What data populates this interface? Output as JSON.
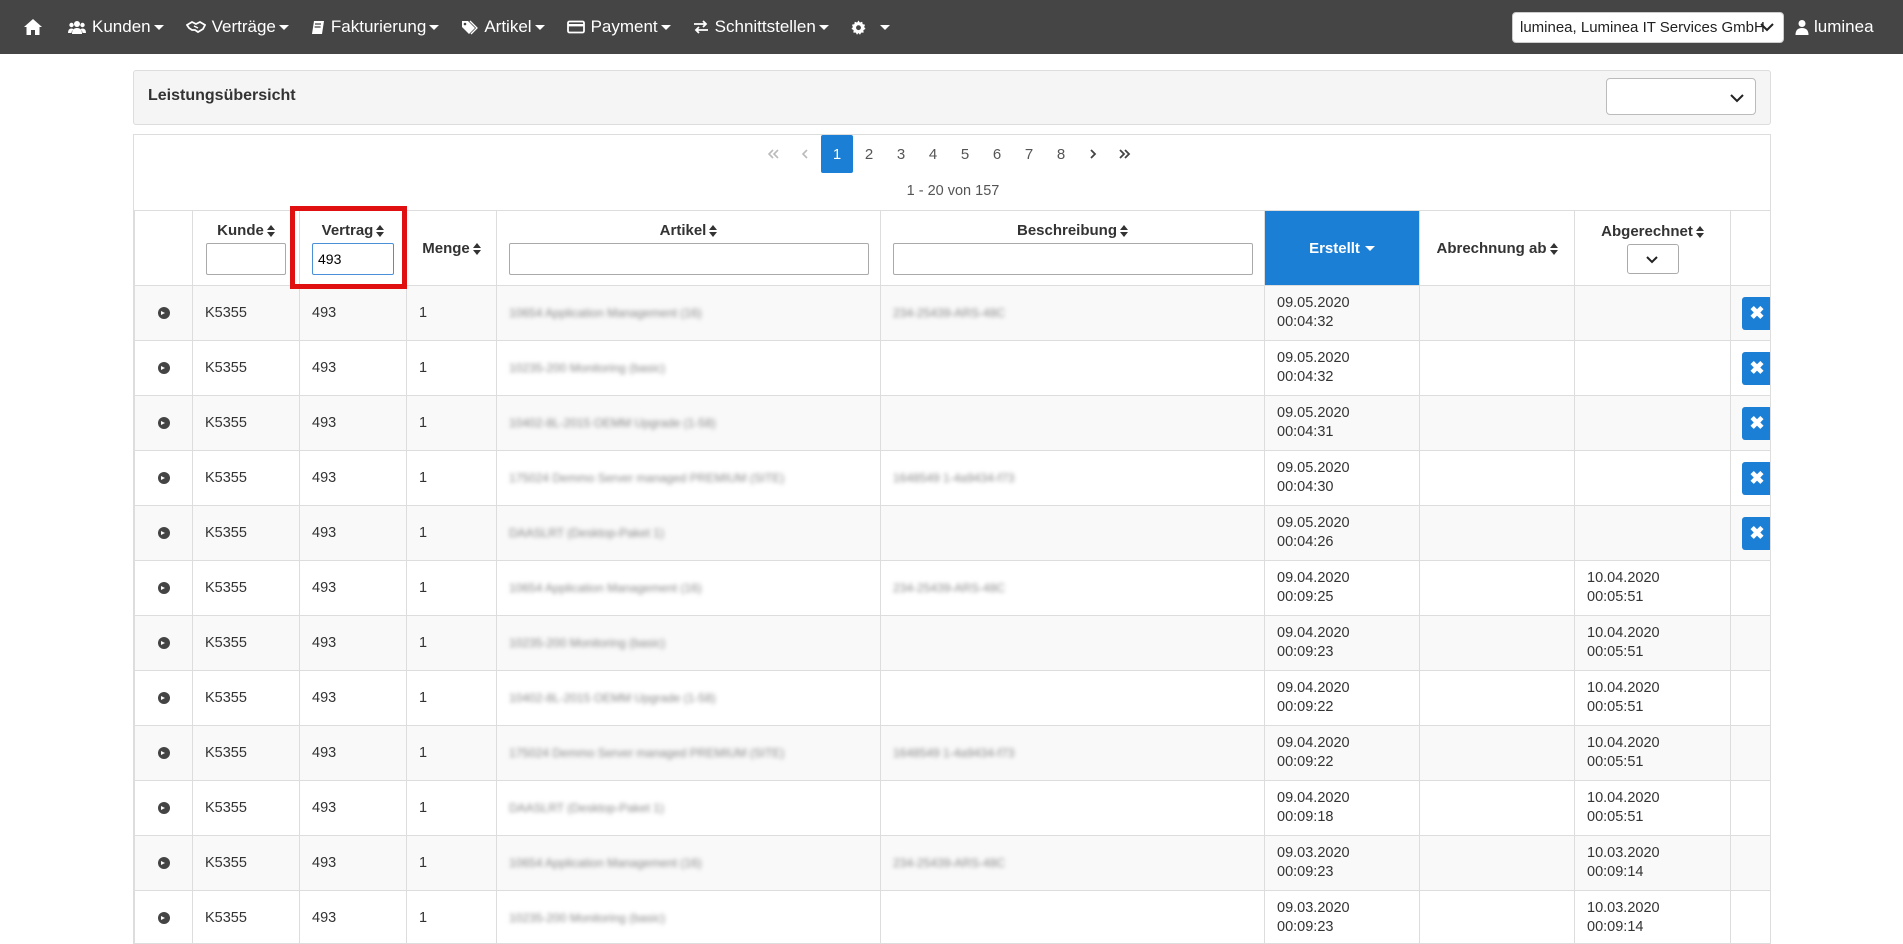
{
  "nav": {
    "items": [
      {
        "label": "Kunden",
        "icon": "users-icon"
      },
      {
        "label": "Verträge",
        "icon": "handshake-icon"
      },
      {
        "label": "Fakturierung",
        "icon": "book-icon"
      },
      {
        "label": "Artikel",
        "icon": "tags-icon"
      },
      {
        "label": "Payment",
        "icon": "credit-card-icon"
      },
      {
        "label": "Schnittstellen",
        "icon": "exchange-icon"
      },
      {
        "label": "",
        "icon": "gear-icon"
      }
    ],
    "tenant": "luminea, Luminea IT Services GmbH",
    "user": "luminea"
  },
  "panel": {
    "title": "Leistungsübersicht"
  },
  "pagination": {
    "pages": [
      "1",
      "2",
      "3",
      "4",
      "5",
      "6",
      "7",
      "8"
    ],
    "active": "1",
    "range_text": "1 - 20 von 157"
  },
  "columns": {
    "kunde": "Kunde",
    "vertrag": "Vertrag",
    "menge": "Menge",
    "artikel": "Artikel",
    "beschreibung": "Beschreibung",
    "erstellt": "Erstellt",
    "abrechnung_ab": "Abrechnung ab",
    "abgerechnet": "Abgerechnet"
  },
  "filters": {
    "kunde": "",
    "vertrag": "493",
    "artikel": "",
    "beschreibung": ""
  },
  "rows": [
    {
      "kunde": "K5355",
      "vertrag": "493",
      "menge": "1",
      "artikel": "10654 Application Management (16)",
      "beschreibung": "234-25439-ARS-48C",
      "erstellt_date": "09.05.2020",
      "erstellt_time": "00:04:32",
      "abgerechnet_date": "",
      "abgerechnet_time": "",
      "deletable": true
    },
    {
      "kunde": "K5355",
      "vertrag": "493",
      "menge": "1",
      "artikel": "10235-200 Monitoring (basic)",
      "beschreibung": "",
      "erstellt_date": "09.05.2020",
      "erstellt_time": "00:04:32",
      "abgerechnet_date": "",
      "abgerechnet_time": "",
      "deletable": true
    },
    {
      "kunde": "K5355",
      "vertrag": "493",
      "menge": "1",
      "artikel": "10402-8L-2015 OEMM Upgrade (1-58)",
      "beschreibung": "",
      "erstellt_date": "09.05.2020",
      "erstellt_time": "00:04:31",
      "abgerechnet_date": "",
      "abgerechnet_time": "",
      "deletable": true
    },
    {
      "kunde": "K5355",
      "vertrag": "493",
      "menge": "1",
      "artikel": "175024 Demmo Server managed PREMIUM (SITE)",
      "beschreibung": "1648549 1-4a9434-f73",
      "erstellt_date": "09.05.2020",
      "erstellt_time": "00:04:30",
      "abgerechnet_date": "",
      "abgerechnet_time": "",
      "deletable": true
    },
    {
      "kunde": "K5355",
      "vertrag": "493",
      "menge": "1",
      "artikel": "DAASLRT (Desktop-Paket 1)",
      "beschreibung": "",
      "erstellt_date": "09.05.2020",
      "erstellt_time": "00:04:26",
      "abgerechnet_date": "",
      "abgerechnet_time": "",
      "deletable": true
    },
    {
      "kunde": "K5355",
      "vertrag": "493",
      "menge": "1",
      "artikel": "10654 Application Management (16)",
      "beschreibung": "234-25439-ARS-48C",
      "erstellt_date": "09.04.2020",
      "erstellt_time": "00:09:25",
      "abgerechnet_date": "10.04.2020",
      "abgerechnet_time": "00:05:51",
      "deletable": false
    },
    {
      "kunde": "K5355",
      "vertrag": "493",
      "menge": "1",
      "artikel": "10235-200 Monitoring (basic)",
      "beschreibung": "",
      "erstellt_date": "09.04.2020",
      "erstellt_time": "00:09:23",
      "abgerechnet_date": "10.04.2020",
      "abgerechnet_time": "00:05:51",
      "deletable": false
    },
    {
      "kunde": "K5355",
      "vertrag": "493",
      "menge": "1",
      "artikel": "10402-8L-2015 OEMM Upgrade (1-58)",
      "beschreibung": "",
      "erstellt_date": "09.04.2020",
      "erstellt_time": "00:09:22",
      "abgerechnet_date": "10.04.2020",
      "abgerechnet_time": "00:05:51",
      "deletable": false
    },
    {
      "kunde": "K5355",
      "vertrag": "493",
      "menge": "1",
      "artikel": "175024 Demmo Server managed PREMIUM (SITE)",
      "beschreibung": "1648549 1-4a9434-f73",
      "erstellt_date": "09.04.2020",
      "erstellt_time": "00:09:22",
      "abgerechnet_date": "10.04.2020",
      "abgerechnet_time": "00:05:51",
      "deletable": false
    },
    {
      "kunde": "K5355",
      "vertrag": "493",
      "menge": "1",
      "artikel": "DAASLRT (Desktop-Paket 1)",
      "beschreibung": "",
      "erstellt_date": "09.04.2020",
      "erstellt_time": "00:09:18",
      "abgerechnet_date": "10.04.2020",
      "abgerechnet_time": "00:05:51",
      "deletable": false
    },
    {
      "kunde": "K5355",
      "vertrag": "493",
      "menge": "1",
      "artikel": "10654 Application Management (16)",
      "beschreibung": "234-25439-ARS-48C",
      "erstellt_date": "09.03.2020",
      "erstellt_time": "00:09:23",
      "abgerechnet_date": "10.03.2020",
      "abgerechnet_time": "00:09:14",
      "deletable": false
    },
    {
      "kunde": "K5355",
      "vertrag": "493",
      "menge": "1",
      "artikel": "10235-200 Monitoring (basic)",
      "beschreibung": "",
      "erstellt_date": "09.03.2020",
      "erstellt_time": "00:09:23",
      "abgerechnet_date": "10.03.2020",
      "abgerechnet_time": "00:09:14",
      "deletable": false
    }
  ]
}
